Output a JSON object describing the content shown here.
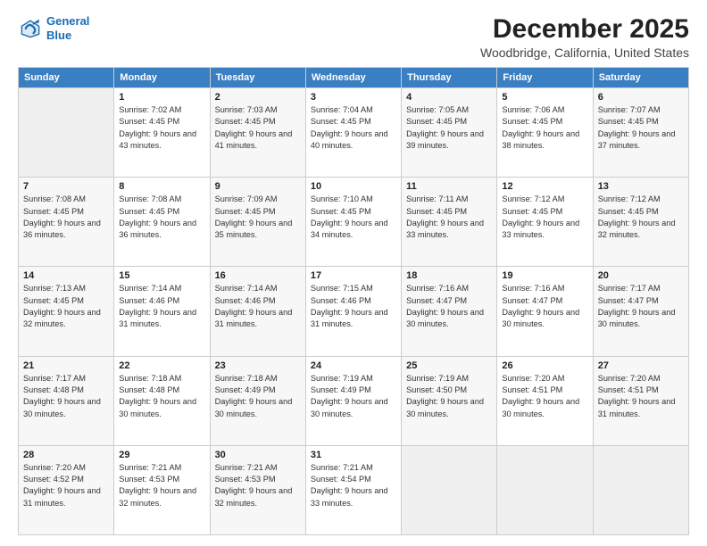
{
  "header": {
    "logo_line1": "General",
    "logo_line2": "Blue",
    "title": "December 2025",
    "subtitle": "Woodbridge, California, United States"
  },
  "days_of_week": [
    "Sunday",
    "Monday",
    "Tuesday",
    "Wednesday",
    "Thursday",
    "Friday",
    "Saturday"
  ],
  "weeks": [
    [
      {
        "day": "",
        "sunrise": "",
        "sunset": "",
        "daylight": ""
      },
      {
        "day": "1",
        "sunrise": "Sunrise: 7:02 AM",
        "sunset": "Sunset: 4:45 PM",
        "daylight": "Daylight: 9 hours and 43 minutes."
      },
      {
        "day": "2",
        "sunrise": "Sunrise: 7:03 AM",
        "sunset": "Sunset: 4:45 PM",
        "daylight": "Daylight: 9 hours and 41 minutes."
      },
      {
        "day": "3",
        "sunrise": "Sunrise: 7:04 AM",
        "sunset": "Sunset: 4:45 PM",
        "daylight": "Daylight: 9 hours and 40 minutes."
      },
      {
        "day": "4",
        "sunrise": "Sunrise: 7:05 AM",
        "sunset": "Sunset: 4:45 PM",
        "daylight": "Daylight: 9 hours and 39 minutes."
      },
      {
        "day": "5",
        "sunrise": "Sunrise: 7:06 AM",
        "sunset": "Sunset: 4:45 PM",
        "daylight": "Daylight: 9 hours and 38 minutes."
      },
      {
        "day": "6",
        "sunrise": "Sunrise: 7:07 AM",
        "sunset": "Sunset: 4:45 PM",
        "daylight": "Daylight: 9 hours and 37 minutes."
      }
    ],
    [
      {
        "day": "7",
        "sunrise": "Sunrise: 7:08 AM",
        "sunset": "Sunset: 4:45 PM",
        "daylight": "Daylight: 9 hours and 36 minutes."
      },
      {
        "day": "8",
        "sunrise": "Sunrise: 7:08 AM",
        "sunset": "Sunset: 4:45 PM",
        "daylight": "Daylight: 9 hours and 36 minutes."
      },
      {
        "day": "9",
        "sunrise": "Sunrise: 7:09 AM",
        "sunset": "Sunset: 4:45 PM",
        "daylight": "Daylight: 9 hours and 35 minutes."
      },
      {
        "day": "10",
        "sunrise": "Sunrise: 7:10 AM",
        "sunset": "Sunset: 4:45 PM",
        "daylight": "Daylight: 9 hours and 34 minutes."
      },
      {
        "day": "11",
        "sunrise": "Sunrise: 7:11 AM",
        "sunset": "Sunset: 4:45 PM",
        "daylight": "Daylight: 9 hours and 33 minutes."
      },
      {
        "day": "12",
        "sunrise": "Sunrise: 7:12 AM",
        "sunset": "Sunset: 4:45 PM",
        "daylight": "Daylight: 9 hours and 33 minutes."
      },
      {
        "day": "13",
        "sunrise": "Sunrise: 7:12 AM",
        "sunset": "Sunset: 4:45 PM",
        "daylight": "Daylight: 9 hours and 32 minutes."
      }
    ],
    [
      {
        "day": "14",
        "sunrise": "Sunrise: 7:13 AM",
        "sunset": "Sunset: 4:45 PM",
        "daylight": "Daylight: 9 hours and 32 minutes."
      },
      {
        "day": "15",
        "sunrise": "Sunrise: 7:14 AM",
        "sunset": "Sunset: 4:46 PM",
        "daylight": "Daylight: 9 hours and 31 minutes."
      },
      {
        "day": "16",
        "sunrise": "Sunrise: 7:14 AM",
        "sunset": "Sunset: 4:46 PM",
        "daylight": "Daylight: 9 hours and 31 minutes."
      },
      {
        "day": "17",
        "sunrise": "Sunrise: 7:15 AM",
        "sunset": "Sunset: 4:46 PM",
        "daylight": "Daylight: 9 hours and 31 minutes."
      },
      {
        "day": "18",
        "sunrise": "Sunrise: 7:16 AM",
        "sunset": "Sunset: 4:47 PM",
        "daylight": "Daylight: 9 hours and 30 minutes."
      },
      {
        "day": "19",
        "sunrise": "Sunrise: 7:16 AM",
        "sunset": "Sunset: 4:47 PM",
        "daylight": "Daylight: 9 hours and 30 minutes."
      },
      {
        "day": "20",
        "sunrise": "Sunrise: 7:17 AM",
        "sunset": "Sunset: 4:47 PM",
        "daylight": "Daylight: 9 hours and 30 minutes."
      }
    ],
    [
      {
        "day": "21",
        "sunrise": "Sunrise: 7:17 AM",
        "sunset": "Sunset: 4:48 PM",
        "daylight": "Daylight: 9 hours and 30 minutes."
      },
      {
        "day": "22",
        "sunrise": "Sunrise: 7:18 AM",
        "sunset": "Sunset: 4:48 PM",
        "daylight": "Daylight: 9 hours and 30 minutes."
      },
      {
        "day": "23",
        "sunrise": "Sunrise: 7:18 AM",
        "sunset": "Sunset: 4:49 PM",
        "daylight": "Daylight: 9 hours and 30 minutes."
      },
      {
        "day": "24",
        "sunrise": "Sunrise: 7:19 AM",
        "sunset": "Sunset: 4:49 PM",
        "daylight": "Daylight: 9 hours and 30 minutes."
      },
      {
        "day": "25",
        "sunrise": "Sunrise: 7:19 AM",
        "sunset": "Sunset: 4:50 PM",
        "daylight": "Daylight: 9 hours and 30 minutes."
      },
      {
        "day": "26",
        "sunrise": "Sunrise: 7:20 AM",
        "sunset": "Sunset: 4:51 PM",
        "daylight": "Daylight: 9 hours and 30 minutes."
      },
      {
        "day": "27",
        "sunrise": "Sunrise: 7:20 AM",
        "sunset": "Sunset: 4:51 PM",
        "daylight": "Daylight: 9 hours and 31 minutes."
      }
    ],
    [
      {
        "day": "28",
        "sunrise": "Sunrise: 7:20 AM",
        "sunset": "Sunset: 4:52 PM",
        "daylight": "Daylight: 9 hours and 31 minutes."
      },
      {
        "day": "29",
        "sunrise": "Sunrise: 7:21 AM",
        "sunset": "Sunset: 4:53 PM",
        "daylight": "Daylight: 9 hours and 32 minutes."
      },
      {
        "day": "30",
        "sunrise": "Sunrise: 7:21 AM",
        "sunset": "Sunset: 4:53 PM",
        "daylight": "Daylight: 9 hours and 32 minutes."
      },
      {
        "day": "31",
        "sunrise": "Sunrise: 7:21 AM",
        "sunset": "Sunset: 4:54 PM",
        "daylight": "Daylight: 9 hours and 33 minutes."
      },
      {
        "day": "",
        "sunrise": "",
        "sunset": "",
        "daylight": ""
      },
      {
        "day": "",
        "sunrise": "",
        "sunset": "",
        "daylight": ""
      },
      {
        "day": "",
        "sunrise": "",
        "sunset": "",
        "daylight": ""
      }
    ]
  ]
}
